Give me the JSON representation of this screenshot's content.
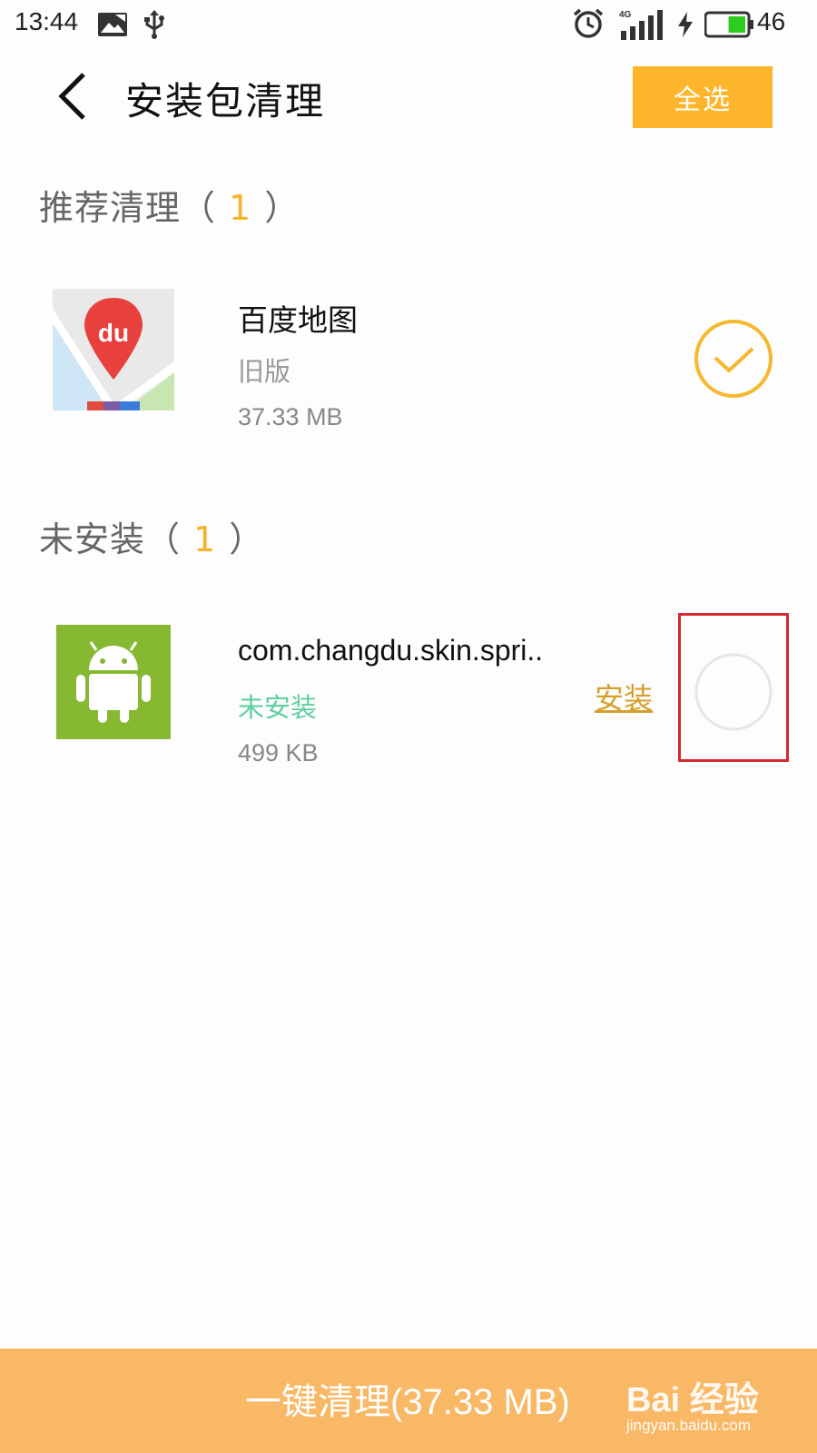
{
  "status_bar": {
    "time": "13:44",
    "network": "4G",
    "battery_level": "46",
    "battery_fraction": 0.46,
    "icons": [
      "gallery-icon",
      "usb-icon",
      "alarm-icon",
      "signal-icon",
      "charging-icon",
      "battery-icon"
    ]
  },
  "header": {
    "title": "安装包清理",
    "select_all": "全选"
  },
  "sections": [
    {
      "title": "推荐清理（",
      "count": "1",
      "close": "）",
      "items": [
        {
          "name": "百度地图",
          "status": "旧版",
          "size": "37.33 MB",
          "selected": true,
          "icon": "baidu-map-icon"
        }
      ]
    },
    {
      "title": "未安装（",
      "count": "1",
      "close": "）",
      "items": [
        {
          "name": "com.changdu.skin.spri..",
          "status": "未安装",
          "size": "499 KB",
          "action": "安装",
          "selected": false,
          "icon": "android-icon"
        }
      ]
    }
  ],
  "bottom": {
    "clean_label": "一键清理(37.33 MB)"
  },
  "watermark": {
    "logo": "Bai 经验",
    "url": "jingyan.baidu.com"
  },
  "colors": {
    "accent": "#fdb52b",
    "bottom_bar": "#f8b866",
    "not_installed": "#5fcfa0",
    "install_link": "#d4a02a",
    "highlight": "#d6282f"
  }
}
